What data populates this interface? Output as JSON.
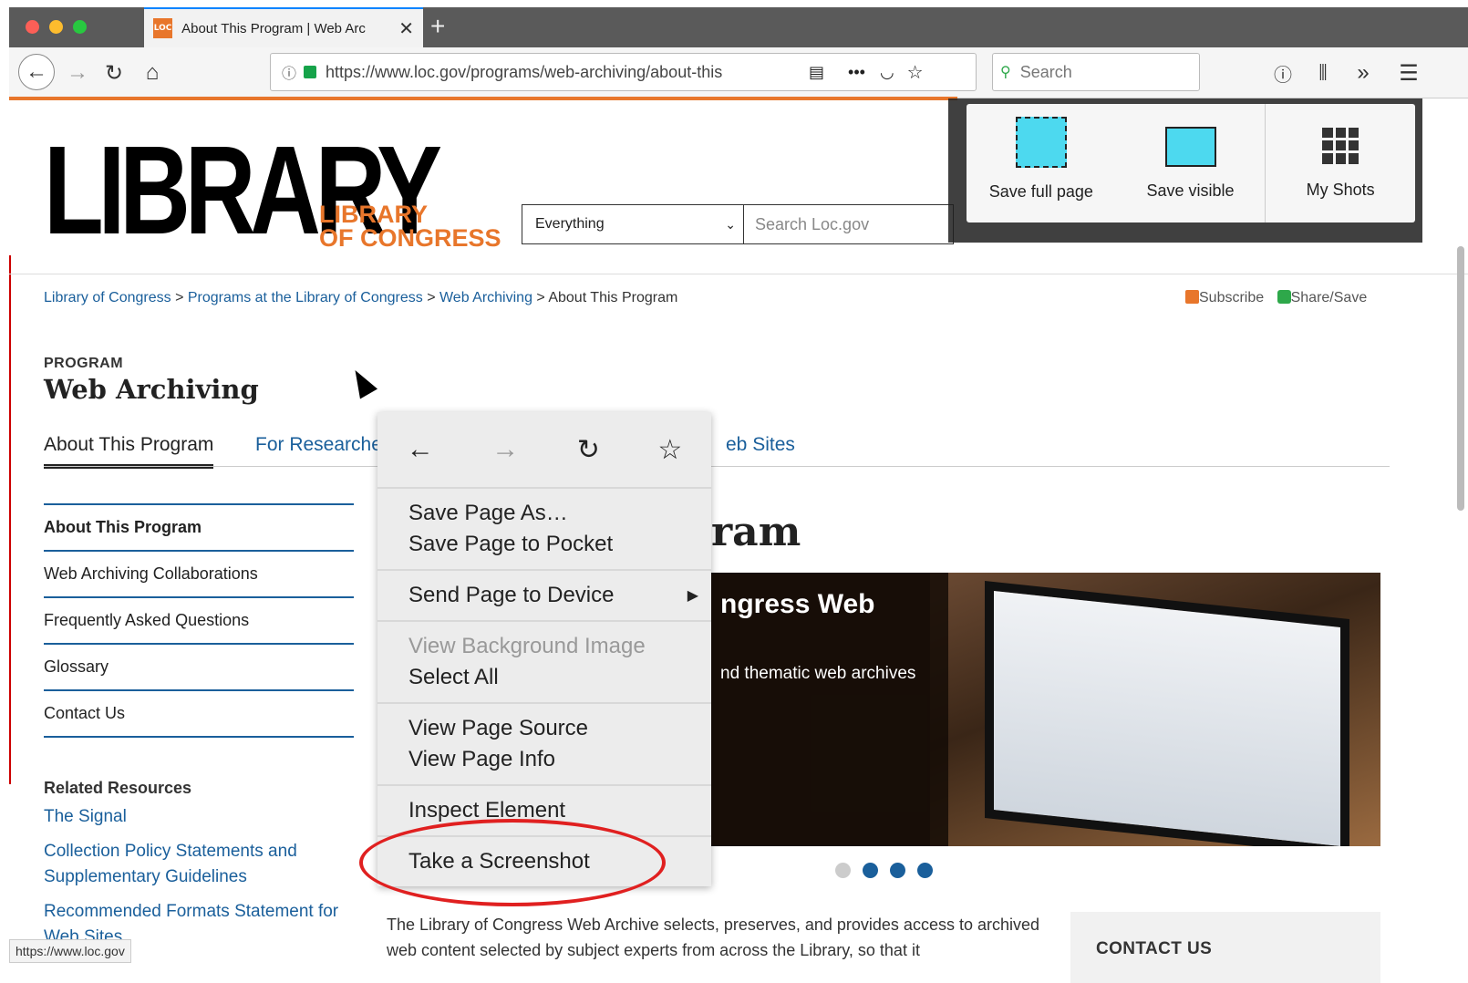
{
  "browser": {
    "tab_title": "About This Program  |  Web Arc",
    "tab_favicon": "LOC",
    "tab_close": "✕",
    "new_tab": "+",
    "url": "https://www.loc.gov/programs/web-archiving/about-this",
    "search_placeholder": "Search",
    "status_url": "https://www.loc.gov"
  },
  "site": {
    "logo_big": "LIBRARY",
    "logo_small_line1": "LIBRARY",
    "logo_small_line2": "OF CONGRESS",
    "search_scope": "Everything",
    "search_placeholder": "Search Loc.gov"
  },
  "breadcrumb": {
    "items": [
      "Library of Congress",
      "Programs at the Library of Congress",
      "Web Archiving"
    ],
    "current": "About This Program",
    "separator": " > "
  },
  "share": {
    "subscribe": "Subscribe",
    "share_save": "Share/Save"
  },
  "program": {
    "kicker": "PROGRAM",
    "title": "Web Archiving"
  },
  "tabs": {
    "about": "About This Program",
    "researchers": "For Researche",
    "websites": "eb Sites"
  },
  "sidenav": [
    "About This Program",
    "Web Archiving Collaborations",
    "Frequently Asked Questions",
    "Glossary",
    "Contact Us"
  ],
  "related": {
    "title": "Related Resources",
    "links": [
      "The Signal",
      "Collection Policy Statements and Supplementary Guidelines",
      "Recommended Formats Statement for Web Sites"
    ]
  },
  "article": {
    "heading_fragment": "ram",
    "carousel_title": "ngress Web",
    "carousel_sub": "nd thematic web archives",
    "body": "The Library of Congress Web Archive selects, preserves, and provides access to archived web content selected by subject experts from across the Library, so that it"
  },
  "contact": {
    "title": "CONTACT US"
  },
  "screenshot_panel": {
    "save_full": "Save full page",
    "save_visible": "Save visible",
    "my_shots": "My Shots"
  },
  "context_menu": {
    "nav": {
      "back": "←",
      "forward": "→",
      "reload": "↻",
      "bookmark": "☆"
    },
    "items": {
      "save_as": "Save Page As…",
      "save_pocket": "Save Page to Pocket",
      "send_device": "Send Page to Device",
      "view_bg": "View Background Image",
      "select_all": "Select All",
      "view_source": "View Page Source",
      "view_info": "View Page Info",
      "inspect": "Inspect Element",
      "screenshot": "Take a Screenshot"
    }
  },
  "colors": {
    "accent_orange": "#e8762b",
    "link_blue": "#1a5f9b",
    "highlight_red": "#e02020"
  }
}
